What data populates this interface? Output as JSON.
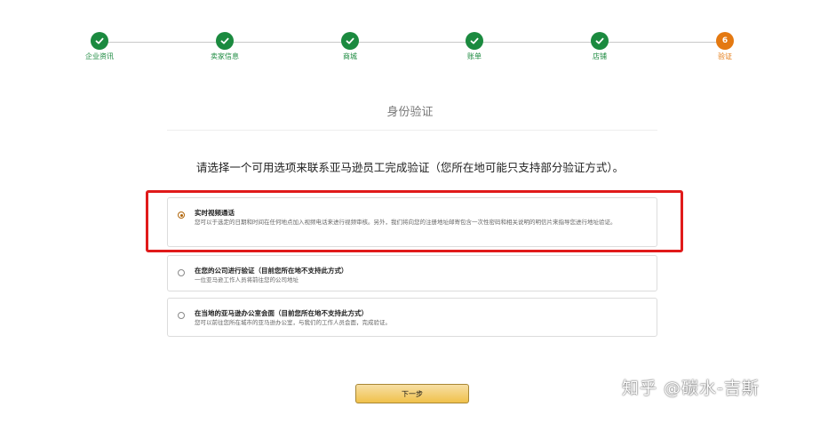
{
  "stepper": {
    "steps": [
      {
        "label": "企业资讯",
        "status": "done"
      },
      {
        "label": "卖家信息",
        "status": "done"
      },
      {
        "label": "商城",
        "status": "done"
      },
      {
        "label": "账单",
        "status": "done"
      },
      {
        "label": "店铺",
        "status": "done"
      },
      {
        "label": "验证",
        "status": "current",
        "number": "6"
      }
    ]
  },
  "page": {
    "title": "身份验证",
    "instruction": "请选择一个可用选项来联系亚马逊员工完成验证（您所在地可能只支持部分验证方式）。"
  },
  "options": [
    {
      "title": "实时视频通话",
      "description": "您可以于选定的日期和时间在任何地点加入视频电话来进行视频审核。另外，我们将向您的注册地址邮寄包含一次性密码和相关说明的明信片来指导您进行地址验证。",
      "selected": true
    },
    {
      "title": "在您的公司进行验证（目前您所在地不支持此方式）",
      "description": "一位亚马逊工作人员将前往您的公司地址",
      "selected": false
    },
    {
      "title": "在当地的亚马逊办公室会面（目前您所在地不支持此方式）",
      "description": "您可以前往您所在城市的亚马逊办公室，与我们的工作人员会面，完成验证。",
      "selected": false
    }
  ],
  "actions": {
    "next_label": "下一步"
  },
  "watermark": "知乎 @碳水-吉斯",
  "colors": {
    "done": "#1b8a3f",
    "current": "#e47911",
    "highlight": "#e01a1a",
    "button": "#f0c14b"
  }
}
